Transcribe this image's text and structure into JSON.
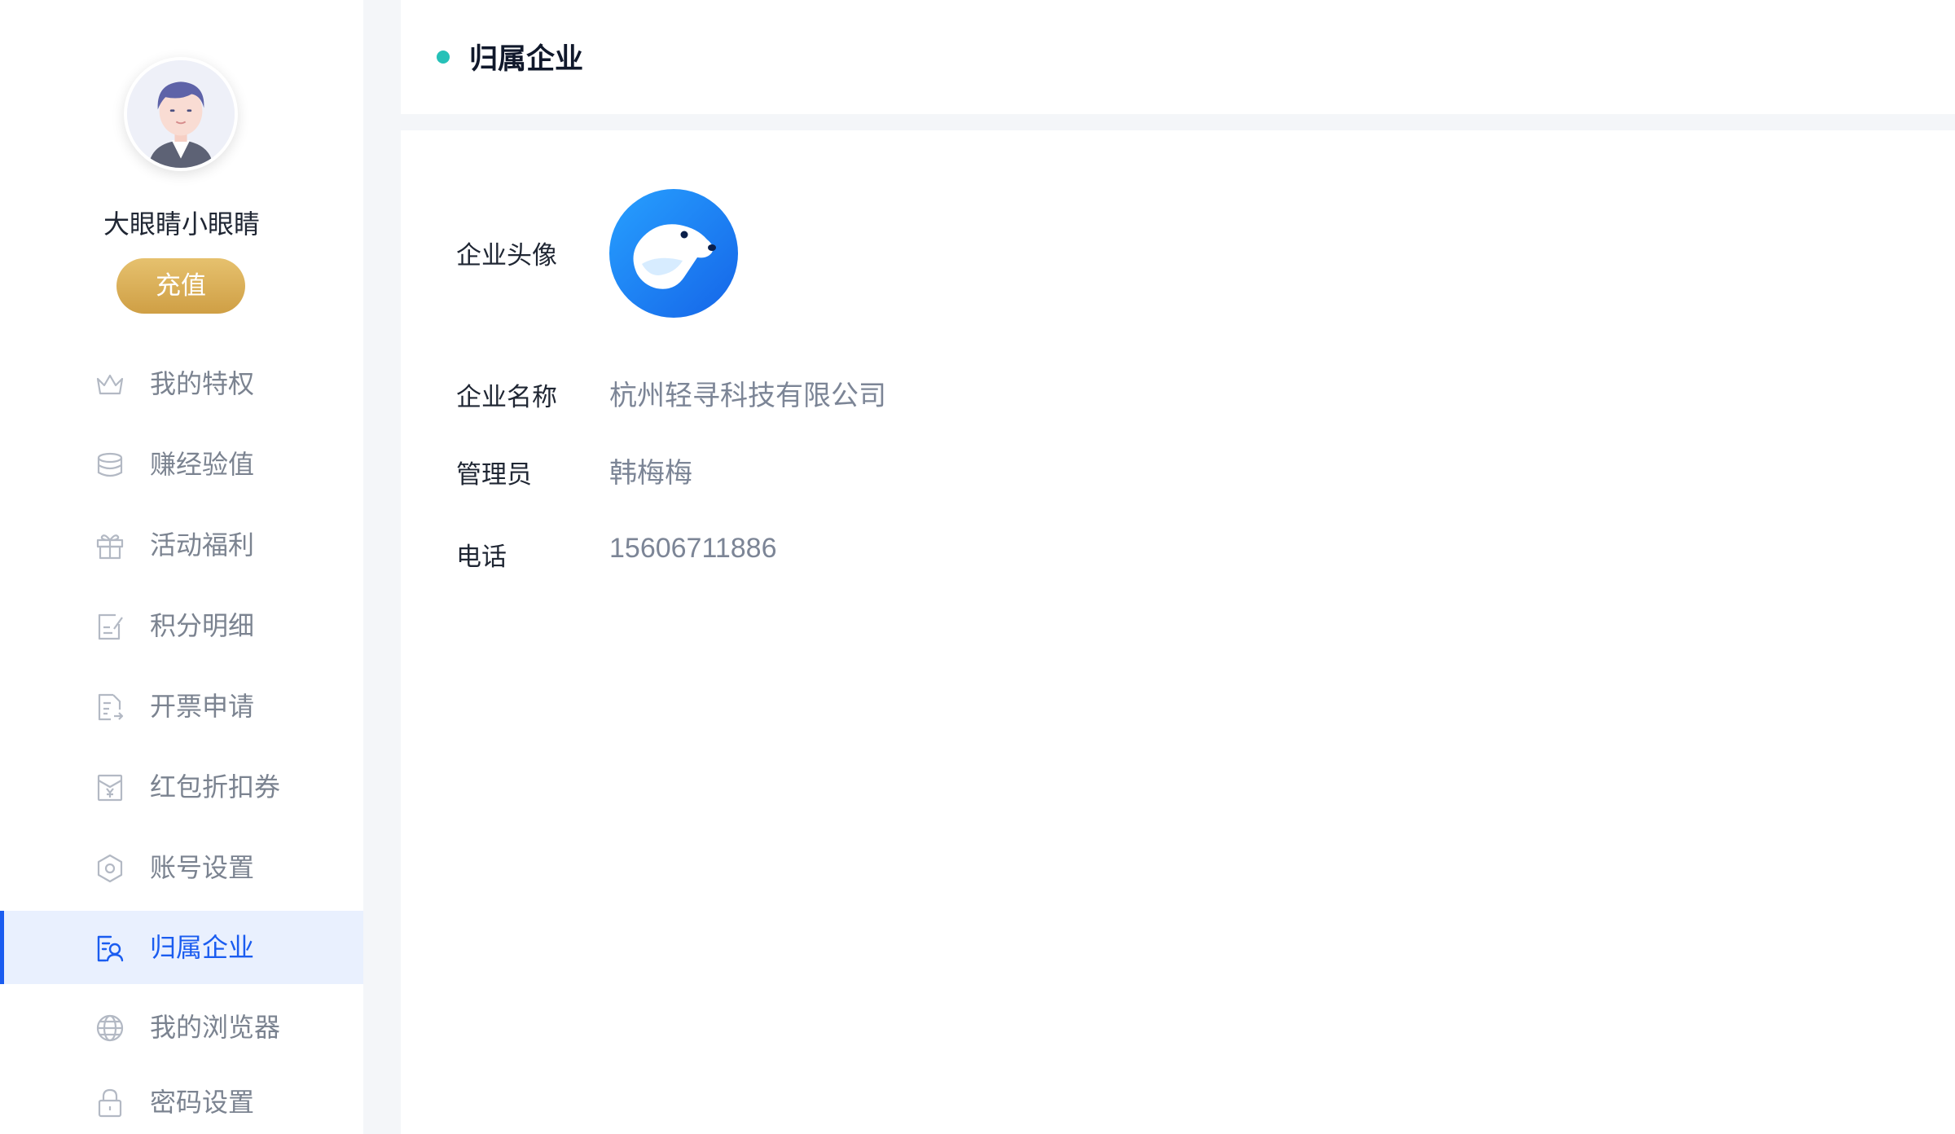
{
  "sidebar": {
    "username": "大眼睛小眼睛",
    "recharge_label": "充值",
    "items": [
      {
        "label": "我的特权",
        "icon": "crown-icon",
        "active": false
      },
      {
        "label": "赚经验值",
        "icon": "coin-stack-icon",
        "active": false
      },
      {
        "label": "活动福利",
        "icon": "gift-icon",
        "active": false
      },
      {
        "label": "积分明细",
        "icon": "edit-document-icon",
        "active": false
      },
      {
        "label": "开票申请",
        "icon": "invoice-icon",
        "active": false
      },
      {
        "label": "红包折扣券",
        "icon": "red-envelope-icon",
        "active": false
      },
      {
        "label": "账号设置",
        "icon": "hexagon-settings-icon",
        "active": false
      },
      {
        "label": "归属企业",
        "icon": "enterprise-user-icon",
        "active": true
      },
      {
        "label": "我的浏览器",
        "icon": "globe-icon",
        "active": false
      },
      {
        "label": "密码设置",
        "icon": "lock-icon",
        "active": false
      }
    ]
  },
  "header": {
    "title": "归属企业"
  },
  "company": {
    "avatar_label": "企业头像",
    "name_label": "企业名称",
    "name_value": "杭州轻寻科技有限公司",
    "admin_label": "管理员",
    "admin_value": "韩梅梅",
    "phone_label": "电话",
    "phone_value": "15606711886"
  },
  "colors": {
    "accent": "#1a5cf0",
    "active_bg": "#e9f0fe",
    "header_dot": "#26c1b8",
    "recharge_gold": "#d9ad57",
    "logo_blue": "#1e88f5"
  }
}
